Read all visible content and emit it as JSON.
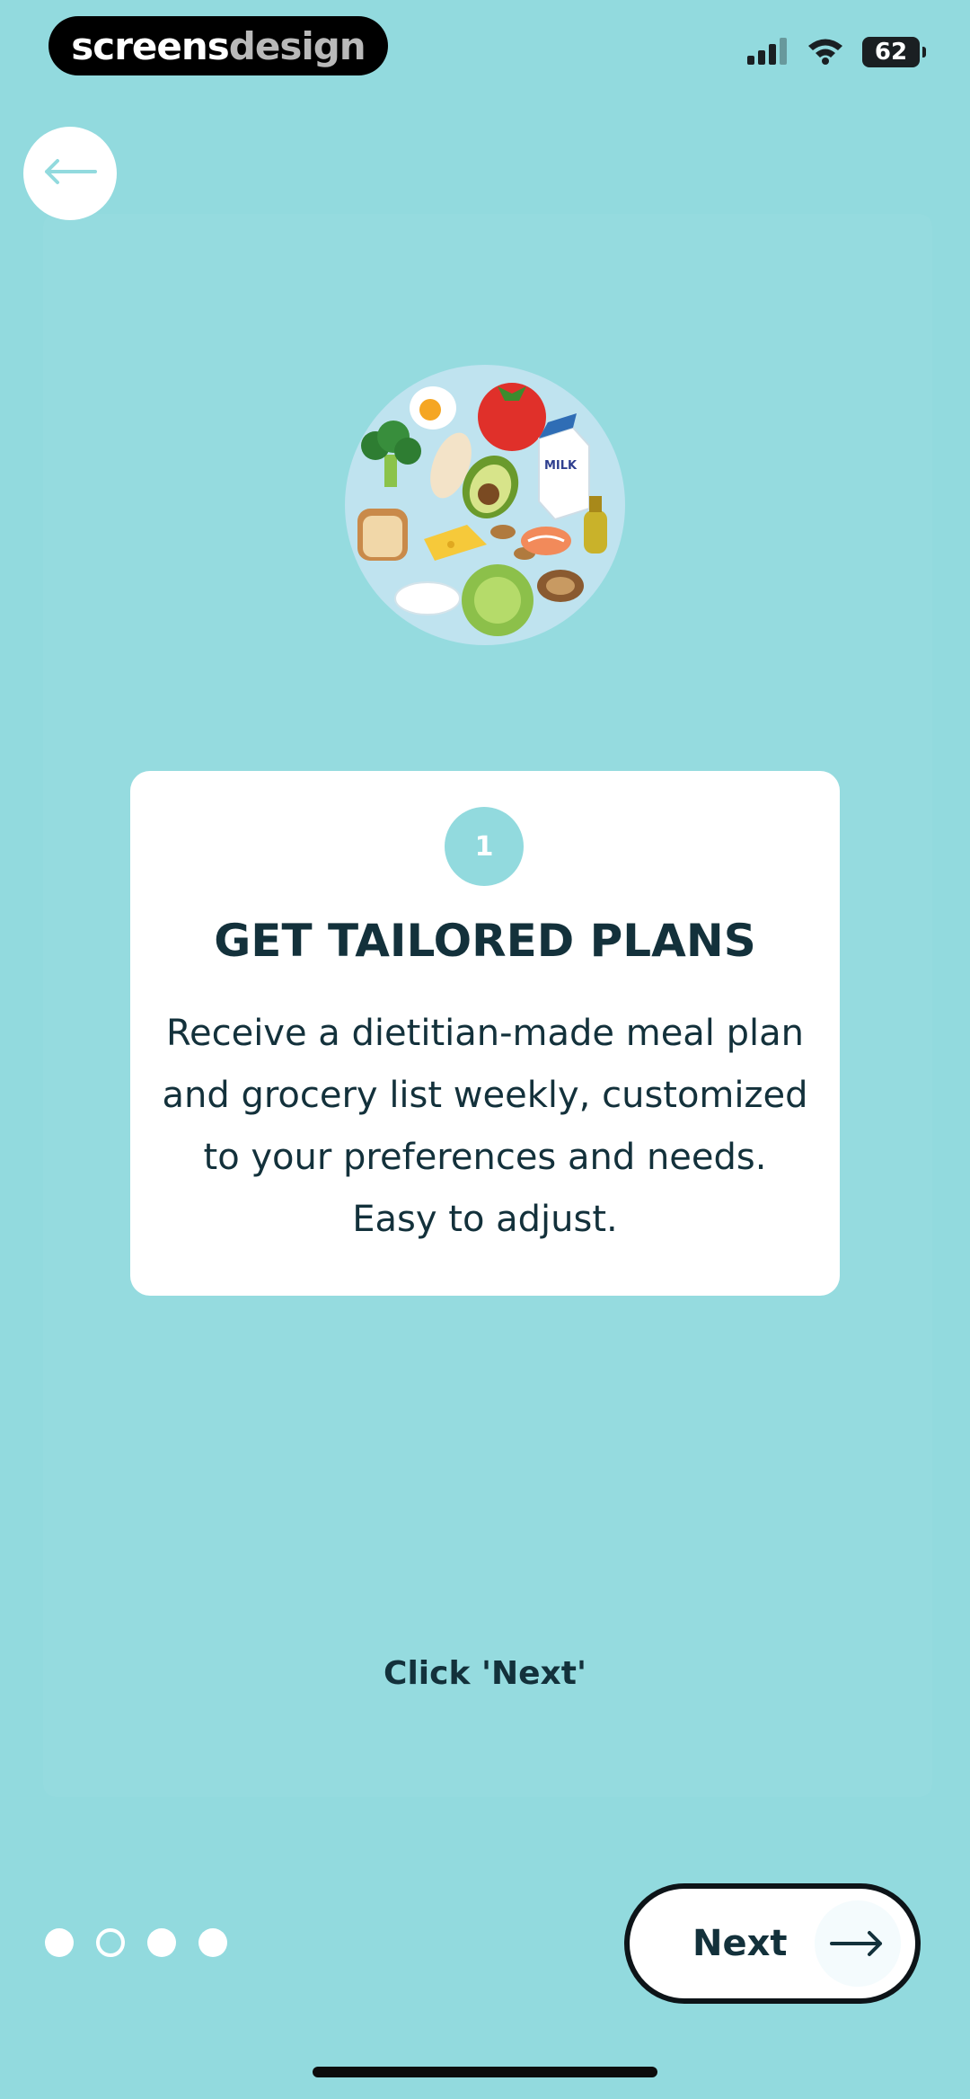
{
  "status_bar": {
    "brand_part1": "screens",
    "brand_part2": "design",
    "battery": "62",
    "icons": [
      "signal-icon",
      "wifi-icon",
      "battery-icon"
    ]
  },
  "nav": {
    "back_icon": "arrow-left-icon"
  },
  "illustration": {
    "name": "food-plate-illustration",
    "milk_label": "MILK"
  },
  "card": {
    "step_number": "1",
    "title": "GET TAILORED PLANS",
    "body": "Receive a dietitian-made meal plan and grocery list weekly, customized to your preferences and needs. Easy to adjust."
  },
  "hint": "Click 'Next'",
  "pagination": {
    "total": 4,
    "current_index": 1
  },
  "next_button": {
    "label": "Next",
    "icon": "arrow-right-icon"
  },
  "colors": {
    "background": "#92dade",
    "text_dark": "#13313b",
    "card": "#ffffff",
    "accent": "#92dade"
  }
}
